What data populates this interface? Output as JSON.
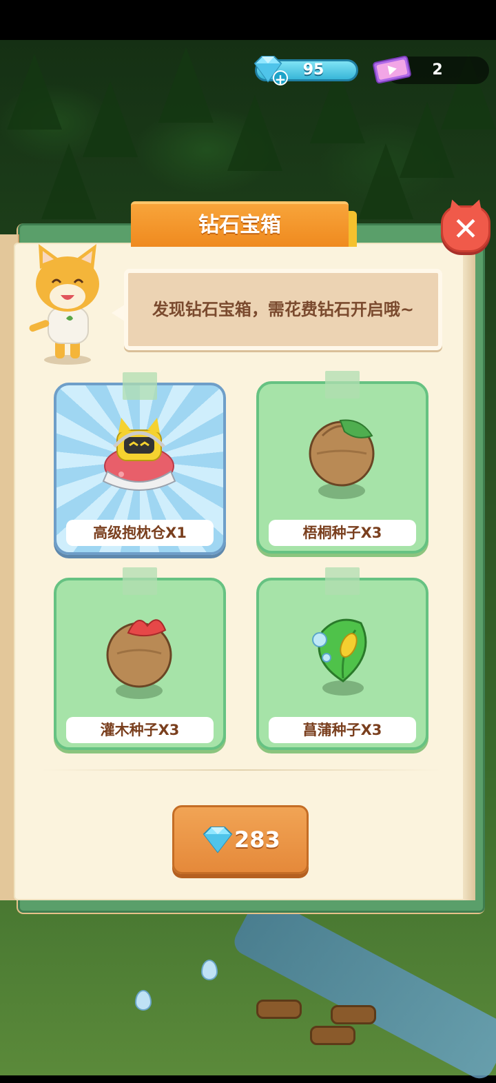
{
  "hud": {
    "diamonds": "95",
    "tickets": "2"
  },
  "dialog": {
    "title": "钻石宝箱",
    "message": "发现钻石宝箱，需花费钻石开启哦~",
    "rewards": [
      {
        "label": "高级抱枕仓X1",
        "icon": "pillow-pod-icon"
      },
      {
        "label": "梧桐种子X3",
        "icon": "parasol-seed-icon"
      },
      {
        "label": "灌木种子X3",
        "icon": "shrub-seed-icon"
      },
      {
        "label": "菖蒲种子X3",
        "icon": "calamus-seed-icon"
      }
    ],
    "price": "283",
    "close_icon": "close-icon"
  },
  "colors": {
    "title_tab": "#ef8a1f",
    "card_green": "#a6e3a8",
    "card_blue": "#9fd6f2",
    "button_orange": "#e5893a",
    "close_red": "#f05a4a"
  }
}
